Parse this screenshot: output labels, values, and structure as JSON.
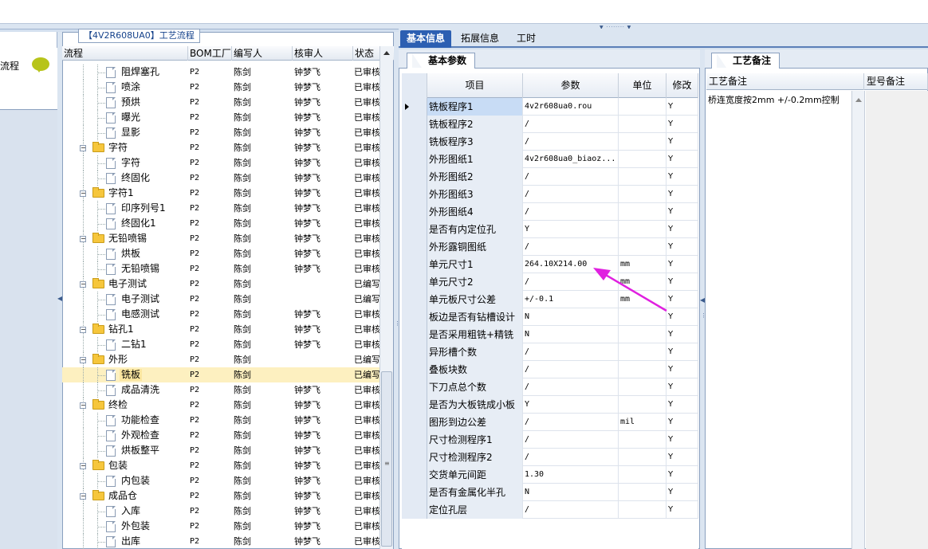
{
  "tree": {
    "title": "【4V2R608UA0】工艺流程",
    "columns": [
      "流程",
      "BOM工厂",
      "编写人",
      "核审人",
      "状态"
    ],
    "rows": [
      {
        "level": 2,
        "type": "doc",
        "name": "阻焊塞孔",
        "bom": "P2",
        "writer": "陈剑",
        "reviewer": "钟梦飞",
        "status": "已审核"
      },
      {
        "level": 2,
        "type": "doc",
        "name": "喷涂",
        "bom": "P2",
        "writer": "陈剑",
        "reviewer": "钟梦飞",
        "status": "已审核"
      },
      {
        "level": 2,
        "type": "doc",
        "name": "预烘",
        "bom": "P2",
        "writer": "陈剑",
        "reviewer": "钟梦飞",
        "status": "已审核"
      },
      {
        "level": 2,
        "type": "doc",
        "name": "曝光",
        "bom": "P2",
        "writer": "陈剑",
        "reviewer": "钟梦飞",
        "status": "已审核"
      },
      {
        "level": 2,
        "type": "doc",
        "name": "显影",
        "bom": "P2",
        "writer": "陈剑",
        "reviewer": "钟梦飞",
        "status": "已审核"
      },
      {
        "level": 1,
        "type": "folder",
        "name": "字符",
        "bom": "P2",
        "writer": "陈剑",
        "reviewer": "钟梦飞",
        "status": "已审核"
      },
      {
        "level": 2,
        "type": "doc",
        "name": "字符",
        "bom": "P2",
        "writer": "陈剑",
        "reviewer": "钟梦飞",
        "status": "已审核"
      },
      {
        "level": 2,
        "type": "doc",
        "name": "终固化",
        "bom": "P2",
        "writer": "陈剑",
        "reviewer": "钟梦飞",
        "status": "已审核"
      },
      {
        "level": 1,
        "type": "folder",
        "name": "字符1",
        "bom": "P2",
        "writer": "陈剑",
        "reviewer": "钟梦飞",
        "status": "已审核"
      },
      {
        "level": 2,
        "type": "doc",
        "name": "印序列号1",
        "bom": "P2",
        "writer": "陈剑",
        "reviewer": "钟梦飞",
        "status": "已审核"
      },
      {
        "level": 2,
        "type": "doc",
        "name": "终固化1",
        "bom": "P2",
        "writer": "陈剑",
        "reviewer": "钟梦飞",
        "status": "已审核"
      },
      {
        "level": 1,
        "type": "folder",
        "name": "无铅喷锡",
        "bom": "P2",
        "writer": "陈剑",
        "reviewer": "钟梦飞",
        "status": "已审核"
      },
      {
        "level": 2,
        "type": "doc",
        "name": "烘板",
        "bom": "P2",
        "writer": "陈剑",
        "reviewer": "钟梦飞",
        "status": "已审核"
      },
      {
        "level": 2,
        "type": "doc",
        "name": "无铅喷锡",
        "bom": "P2",
        "writer": "陈剑",
        "reviewer": "钟梦飞",
        "status": "已审核"
      },
      {
        "level": 1,
        "type": "folder",
        "name": "电子测试",
        "bom": "P2",
        "writer": "陈剑",
        "reviewer": "",
        "status": "已编写"
      },
      {
        "level": 2,
        "type": "doc",
        "name": "电子测试",
        "bom": "P2",
        "writer": "陈剑",
        "reviewer": "",
        "status": "已编写"
      },
      {
        "level": 2,
        "type": "doc",
        "name": "电感测试",
        "bom": "P2",
        "writer": "陈剑",
        "reviewer": "钟梦飞",
        "status": "已审核"
      },
      {
        "level": 1,
        "type": "folder",
        "name": "钻孔1",
        "bom": "P2",
        "writer": "陈剑",
        "reviewer": "钟梦飞",
        "status": "已审核"
      },
      {
        "level": 2,
        "type": "doc",
        "name": "二钻1",
        "bom": "P2",
        "writer": "陈剑",
        "reviewer": "钟梦飞",
        "status": "已审核"
      },
      {
        "level": 1,
        "type": "folder",
        "name": "外形",
        "bom": "P2",
        "writer": "陈剑",
        "reviewer": "",
        "status": "已编写"
      },
      {
        "level": 2,
        "type": "doc",
        "name": "铣板",
        "bom": "P2",
        "writer": "陈剑",
        "reviewer": "",
        "status": "已编写",
        "selected": true
      },
      {
        "level": 2,
        "type": "doc",
        "name": "成品清洗",
        "bom": "P2",
        "writer": "陈剑",
        "reviewer": "钟梦飞",
        "status": "已审核"
      },
      {
        "level": 1,
        "type": "folder",
        "name": "终检",
        "bom": "P2",
        "writer": "陈剑",
        "reviewer": "钟梦飞",
        "status": "已审核"
      },
      {
        "level": 2,
        "type": "doc",
        "name": "功能检查",
        "bom": "P2",
        "writer": "陈剑",
        "reviewer": "钟梦飞",
        "status": "已审核"
      },
      {
        "level": 2,
        "type": "doc",
        "name": "外观检查",
        "bom": "P2",
        "writer": "陈剑",
        "reviewer": "钟梦飞",
        "status": "已审核"
      },
      {
        "level": 2,
        "type": "doc",
        "name": "烘板整平",
        "bom": "P2",
        "writer": "陈剑",
        "reviewer": "钟梦飞",
        "status": "已审核"
      },
      {
        "level": 1,
        "type": "folder",
        "name": "包装",
        "bom": "P2",
        "writer": "陈剑",
        "reviewer": "钟梦飞",
        "status": "已审核"
      },
      {
        "level": 2,
        "type": "doc",
        "name": "内包装",
        "bom": "P2",
        "writer": "陈剑",
        "reviewer": "钟梦飞",
        "status": "已审核"
      },
      {
        "level": 1,
        "type": "folder",
        "name": "成品仓",
        "bom": "P2",
        "writer": "陈剑",
        "reviewer": "钟梦飞",
        "status": "已审核"
      },
      {
        "level": 2,
        "type": "doc",
        "name": "入库",
        "bom": "P2",
        "writer": "陈剑",
        "reviewer": "钟梦飞",
        "status": "已审核"
      },
      {
        "level": 2,
        "type": "doc",
        "name": "外包装",
        "bom": "P2",
        "writer": "陈剑",
        "reviewer": "钟梦飞",
        "status": "已审核"
      },
      {
        "level": 2,
        "type": "doc",
        "name": "出库",
        "bom": "P2",
        "writer": "陈剑",
        "reviewer": "钟梦飞",
        "status": "已审核"
      }
    ]
  },
  "left_strip": {
    "label": "流程",
    "bubble_icon": "chat-bubble-icon"
  },
  "main_tabs": [
    "基本信息",
    "拓展信息",
    "工时"
  ],
  "basic": {
    "tab": "基本参数",
    "columns": [
      "项目",
      "参数",
      "单位",
      "修改"
    ],
    "rows": [
      {
        "item": "铣板程序1",
        "param": "4v2r608ua0.rou",
        "unit": "",
        "mod": "Y",
        "current": true
      },
      {
        "item": "铣板程序2",
        "param": "/",
        "unit": "",
        "mod": "Y"
      },
      {
        "item": "铣板程序3",
        "param": "/",
        "unit": "",
        "mod": "Y"
      },
      {
        "item": "外形图纸1",
        "param": "4v2r608ua0_biaoz...",
        "unit": "",
        "mod": "Y"
      },
      {
        "item": "外形图纸2",
        "param": "/",
        "unit": "",
        "mod": "Y"
      },
      {
        "item": "外形图纸3",
        "param": "/",
        "unit": "",
        "mod": "Y"
      },
      {
        "item": "外形图纸4",
        "param": "/",
        "unit": "",
        "mod": "Y"
      },
      {
        "item": "是否有内定位孔",
        "param": "Y",
        "unit": "",
        "mod": "Y"
      },
      {
        "item": "外形露铜图纸",
        "param": "/",
        "unit": "",
        "mod": "Y"
      },
      {
        "item": "单元尺寸1",
        "param": "264.10X214.00",
        "unit": "mm",
        "mod": "Y"
      },
      {
        "item": "单元尺寸2",
        "param": "/",
        "unit": "mm",
        "mod": "Y"
      },
      {
        "item": "单元板尺寸公差",
        "param": "+/-0.1",
        "unit": "mm",
        "mod": "Y"
      },
      {
        "item": "板边是否有钻槽设计",
        "param": "N",
        "unit": "",
        "mod": "Y"
      },
      {
        "item": "是否采用粗铣+精铣",
        "param": "N",
        "unit": "",
        "mod": "Y"
      },
      {
        "item": "异形槽个数",
        "param": "/",
        "unit": "",
        "mod": "Y"
      },
      {
        "item": "叠板块数",
        "param": "/",
        "unit": "",
        "mod": "Y"
      },
      {
        "item": "下刀点总个数",
        "param": "/",
        "unit": "",
        "mod": "Y"
      },
      {
        "item": "是否为大板铣成小板",
        "param": "Y",
        "unit": "",
        "mod": "Y"
      },
      {
        "item": "图形到边公差",
        "param": "/",
        "unit": "mil",
        "mod": "Y"
      },
      {
        "item": "尺寸检测程序1",
        "param": "/",
        "unit": "",
        "mod": "Y"
      },
      {
        "item": "尺寸检测程序2",
        "param": "/",
        "unit": "",
        "mod": "Y"
      },
      {
        "item": "交货单元间距",
        "param": "1.30",
        "unit": "",
        "mod": "Y"
      },
      {
        "item": "是否有金属化半孔",
        "param": "N",
        "unit": "",
        "mod": "Y"
      },
      {
        "item": "定位孔层",
        "param": "/",
        "unit": "",
        "mod": "Y"
      }
    ]
  },
  "remarks": {
    "tab": "工艺备注",
    "columns": [
      "工艺备注",
      "型号备注"
    ],
    "text": "桥连宽度按2mm +/-0.2mm控制"
  },
  "annotation": {
    "color": "#e020e0"
  }
}
